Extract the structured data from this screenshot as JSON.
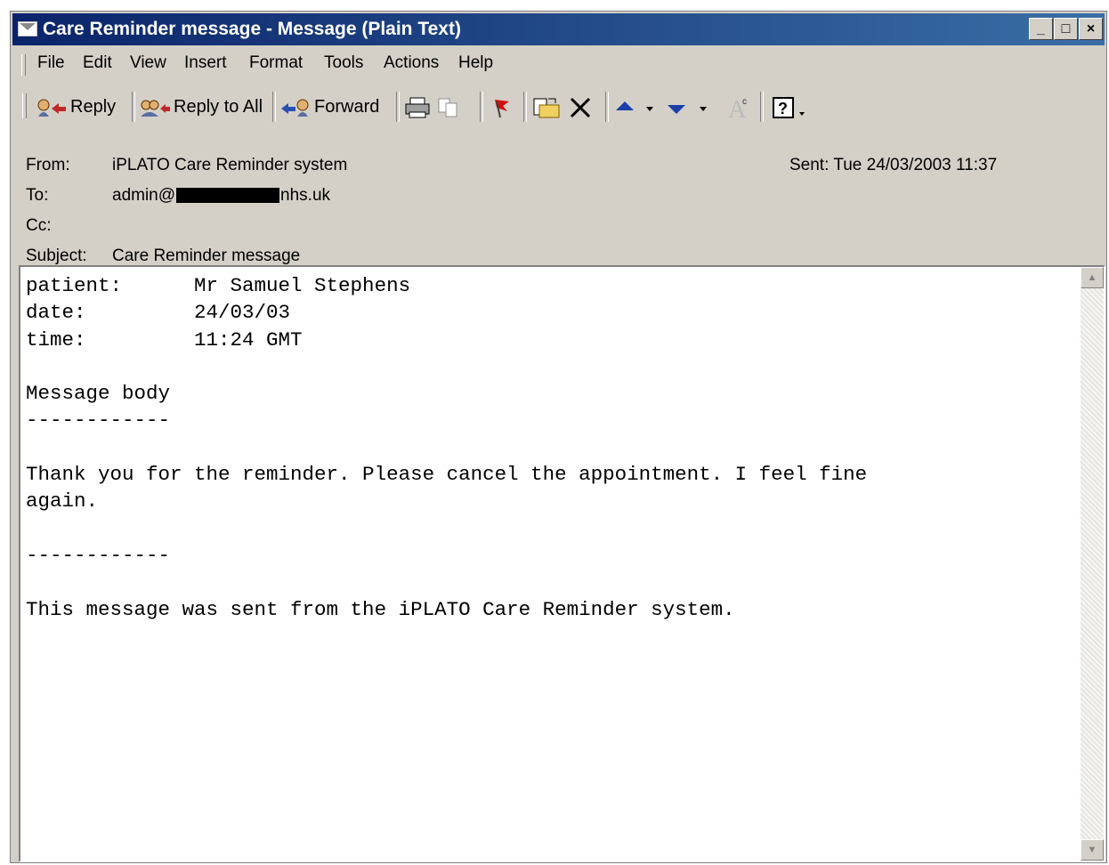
{
  "window": {
    "title": "Care Reminder message - Message (Plain Text)",
    "controls": {
      "minimize": "_",
      "maximize": "□",
      "close": "×"
    }
  },
  "menu": [
    "File",
    "Edit",
    "View",
    "Insert",
    "Format",
    "Tools",
    "Actions",
    "Help"
  ],
  "toolbar": {
    "reply": "Reply",
    "reply_all": "Reply to All",
    "forward": "Forward"
  },
  "header": {
    "from_label": "From:",
    "from": "iPLATO Care Reminder system",
    "sent_label": "Sent:",
    "sent": "Tue 24/03/2003 11:37",
    "to_label": "To:",
    "to_prefix": "admin@",
    "to_suffix": "nhs.uk",
    "cc_label": "Cc:",
    "cc": "",
    "subject_label": "Subject:",
    "subject": "Care Reminder message"
  },
  "body": {
    "text": "patient:      Mr Samuel Stephens\ndate:         24/03/03\ntime:         11:24 GMT\n\nMessage body\n------------\n\nThank you for the reminder. Please cancel the appointment. I feel fine\nagain.\n\n------------\n\nThis message was sent from the iPLATO Care Reminder system."
  },
  "colors": {
    "titlebar_start": "#0a246a",
    "titlebar_end": "#3a6ea5",
    "chrome": "#d4d0c8"
  }
}
